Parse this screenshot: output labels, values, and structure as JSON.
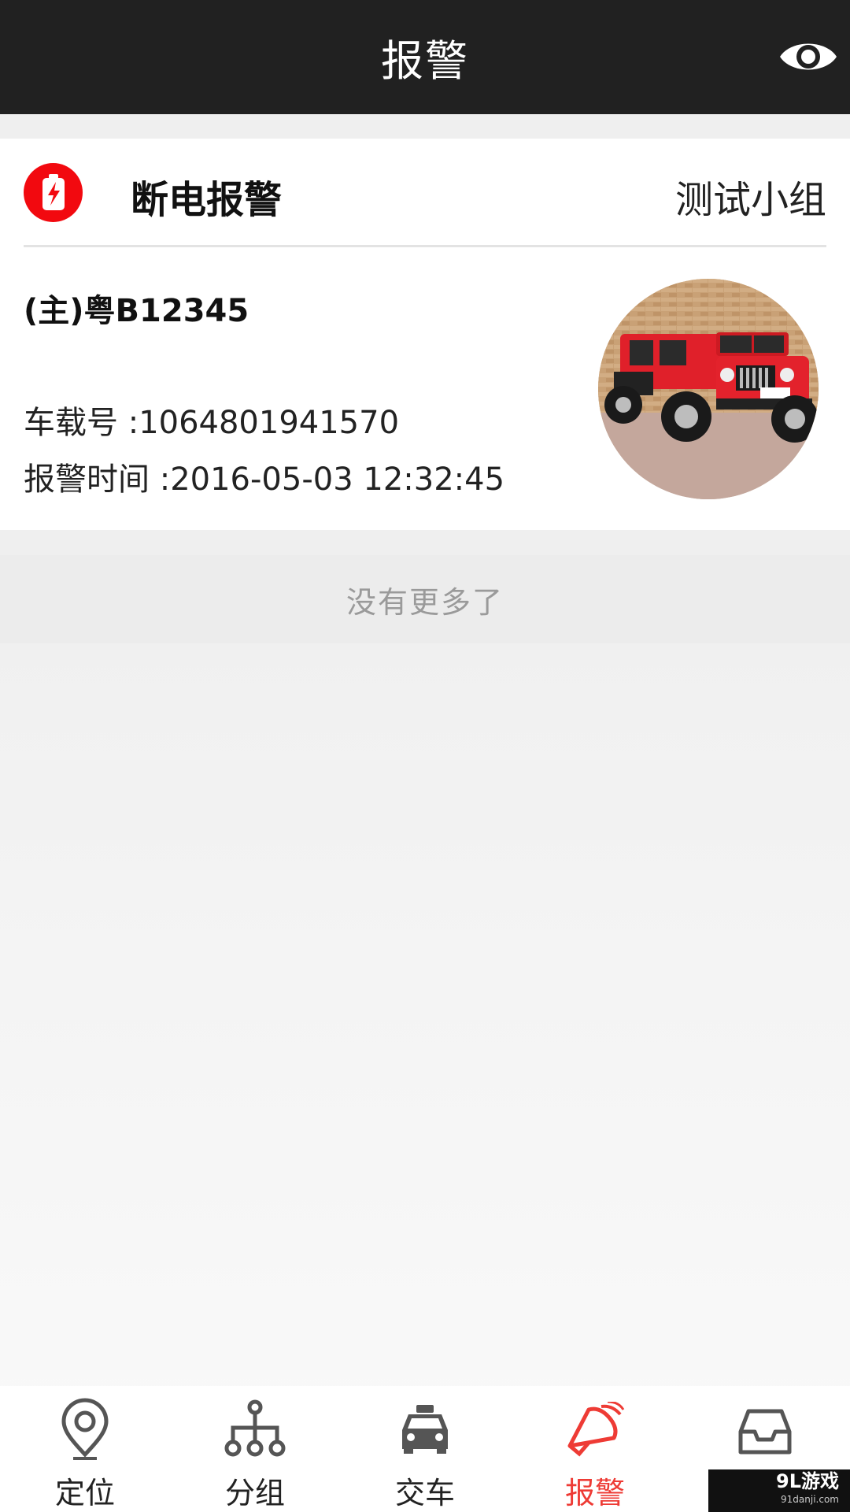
{
  "header": {
    "title": "报警"
  },
  "alarm_card": {
    "type": "断电报警",
    "group": "测试小组",
    "plate": "(主)粤B12345",
    "device_line": "车载号 :1064801941570",
    "time_line": "报警时间 :2016-05-03 12:32:45"
  },
  "list_footer": "没有更多了",
  "tabs": [
    {
      "label": "定位",
      "icon": "location-pin-icon",
      "active": false
    },
    {
      "label": "分组",
      "icon": "hierarchy-icon",
      "active": false
    },
    {
      "label": "交车",
      "icon": "car-icon",
      "active": false
    },
    {
      "label": "报警",
      "icon": "alarm-siren-icon",
      "active": true
    },
    {
      "label": "",
      "icon": "inbox-icon",
      "active": false
    }
  ],
  "watermark": {
    "main": "9L游戏",
    "sub": "91danji.com"
  },
  "colors": {
    "header_bg": "#212121",
    "accent": "#ee3b35",
    "alarm_red": "#f2090f"
  }
}
